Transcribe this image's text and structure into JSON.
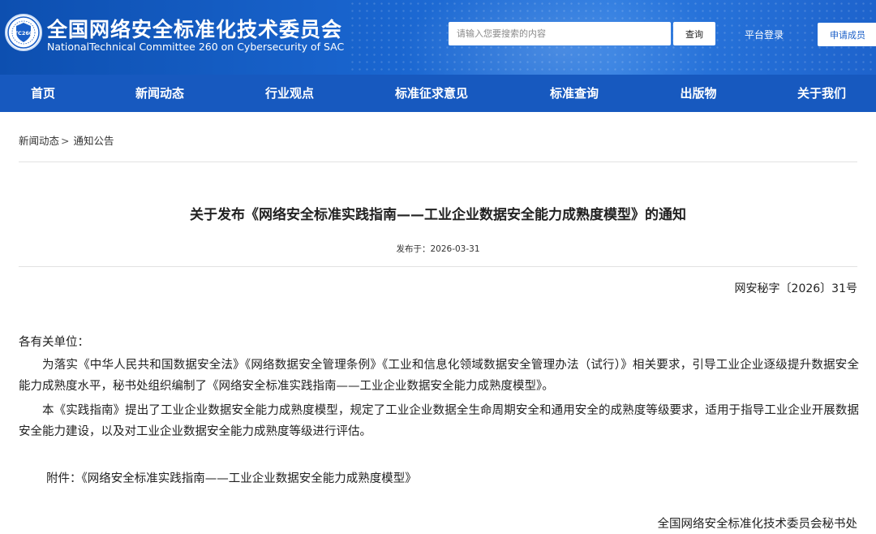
{
  "header": {
    "title_cn": "全国网络安全标准化技术委员会",
    "title_en": "NationalTechnical Committee 260 on Cybersecurity of SAC",
    "logo_text": "TC260",
    "search_placeholder": "请输入您要搜索的内容",
    "search_button": "查询",
    "login_link": "平台登录",
    "join_button": "申请成员"
  },
  "nav": {
    "items": [
      "首页",
      "新闻动态",
      "行业观点",
      "标准征求意见",
      "标准查询",
      "出版物",
      "关于我们"
    ]
  },
  "breadcrumb": {
    "level1": "新闻动态",
    "separator": ">",
    "level2": "通知公告"
  },
  "article": {
    "title": "关于发布《网络安全标准实践指南——工业企业数据安全能力成熟度模型》的通知",
    "publish_date": "发布于：2026-03-31",
    "doc_number": "网安秘字〔2026〕31号",
    "salutation": "各有关单位：",
    "paragraphs": [
      "为落实《中华人民共和国数据安全法》《网络数据安全管理条例》《工业和信息化领域数据安全管理办法（试行）》相关要求，引导工业企业逐级提升数据安全能力成熟度水平，秘书处组织编制了《网络安全标准实践指南——工业企业数据安全能力成熟度模型》。",
      "本《实践指南》提出了工业企业数据安全能力成熟度模型，规定了工业企业数据全生命周期安全和通用安全的成熟度等级要求，适用于指导工业企业开展数据安全能力建设，以及对工业企业数据安全能力成熟度等级进行评估。"
    ],
    "attachment": "附件：《网络安全标准实践指南——工业企业数据安全能力成熟度模型》",
    "signature": "全国网络安全标准化技术委员会秘书处"
  },
  "colors": {
    "header_blue": "#1a66d0",
    "nav_blue": "#1759bf",
    "text": "#222222"
  }
}
